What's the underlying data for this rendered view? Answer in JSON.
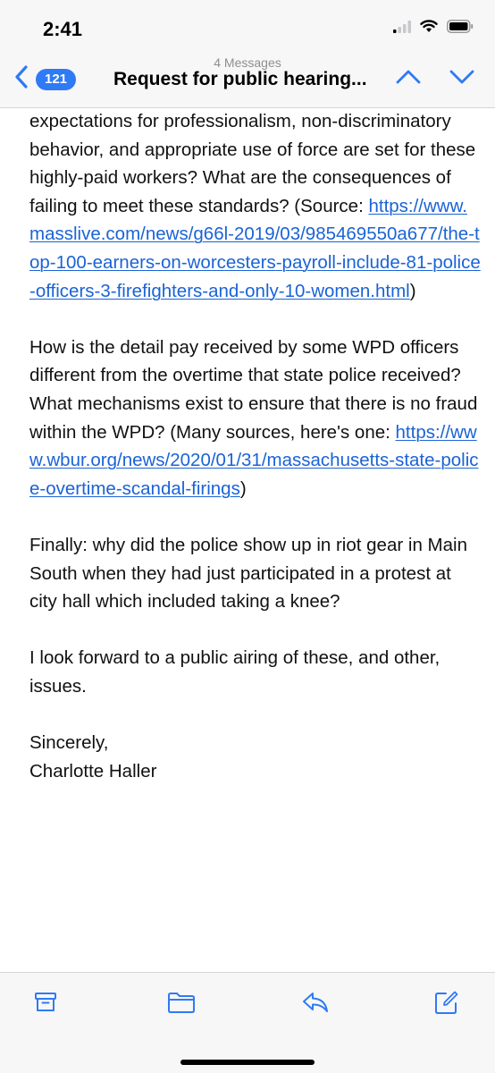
{
  "status": {
    "time": "2:41"
  },
  "nav": {
    "back_count": "121",
    "message_count": "4 Messages",
    "title": "Request for public hearing..."
  },
  "body": {
    "p1_text": "expectations for professionalism, non-discriminatory behavior, and appropriate use of force are set for these highly-paid workers? What are the consequences of failing to meet these standards?  (Source:  ",
    "p1_link": "https://www.masslive.com/news/g66l-2019/03/985469550a677/the-top-100-earners-on-worcesters-payroll-include-81-police-officers-3-firefighters-and-only-10-women.html",
    "p1_end": ")",
    "p2_text": "How is the detail pay received by some WPD officers different from the overtime that state police received?  What mechanisms exist to ensure that there is no fraud within the WPD?  (Many sources, here's one:  ",
    "p2_link": "https://www.wbur.org/news/2020/01/31/massachusetts-state-police-overtime-scandal-firings",
    "p2_end": ")",
    "p3_text": "Finally:  why did the police show up in riot gear in Main South when they had just participated in a protest at city hall which included taking a knee?",
    "p4_text": "I look forward to a public airing of these, and other, issues.",
    "closing": "Sincerely,",
    "signature": "Charlotte Haller"
  },
  "toolbar": {
    "icons": [
      "archive-icon",
      "folder-icon",
      "reply-icon",
      "compose-icon"
    ]
  },
  "colors": {
    "accent": "#2f7af5",
    "link": "#1a63d6",
    "bar_bg": "#f7f7f7"
  }
}
